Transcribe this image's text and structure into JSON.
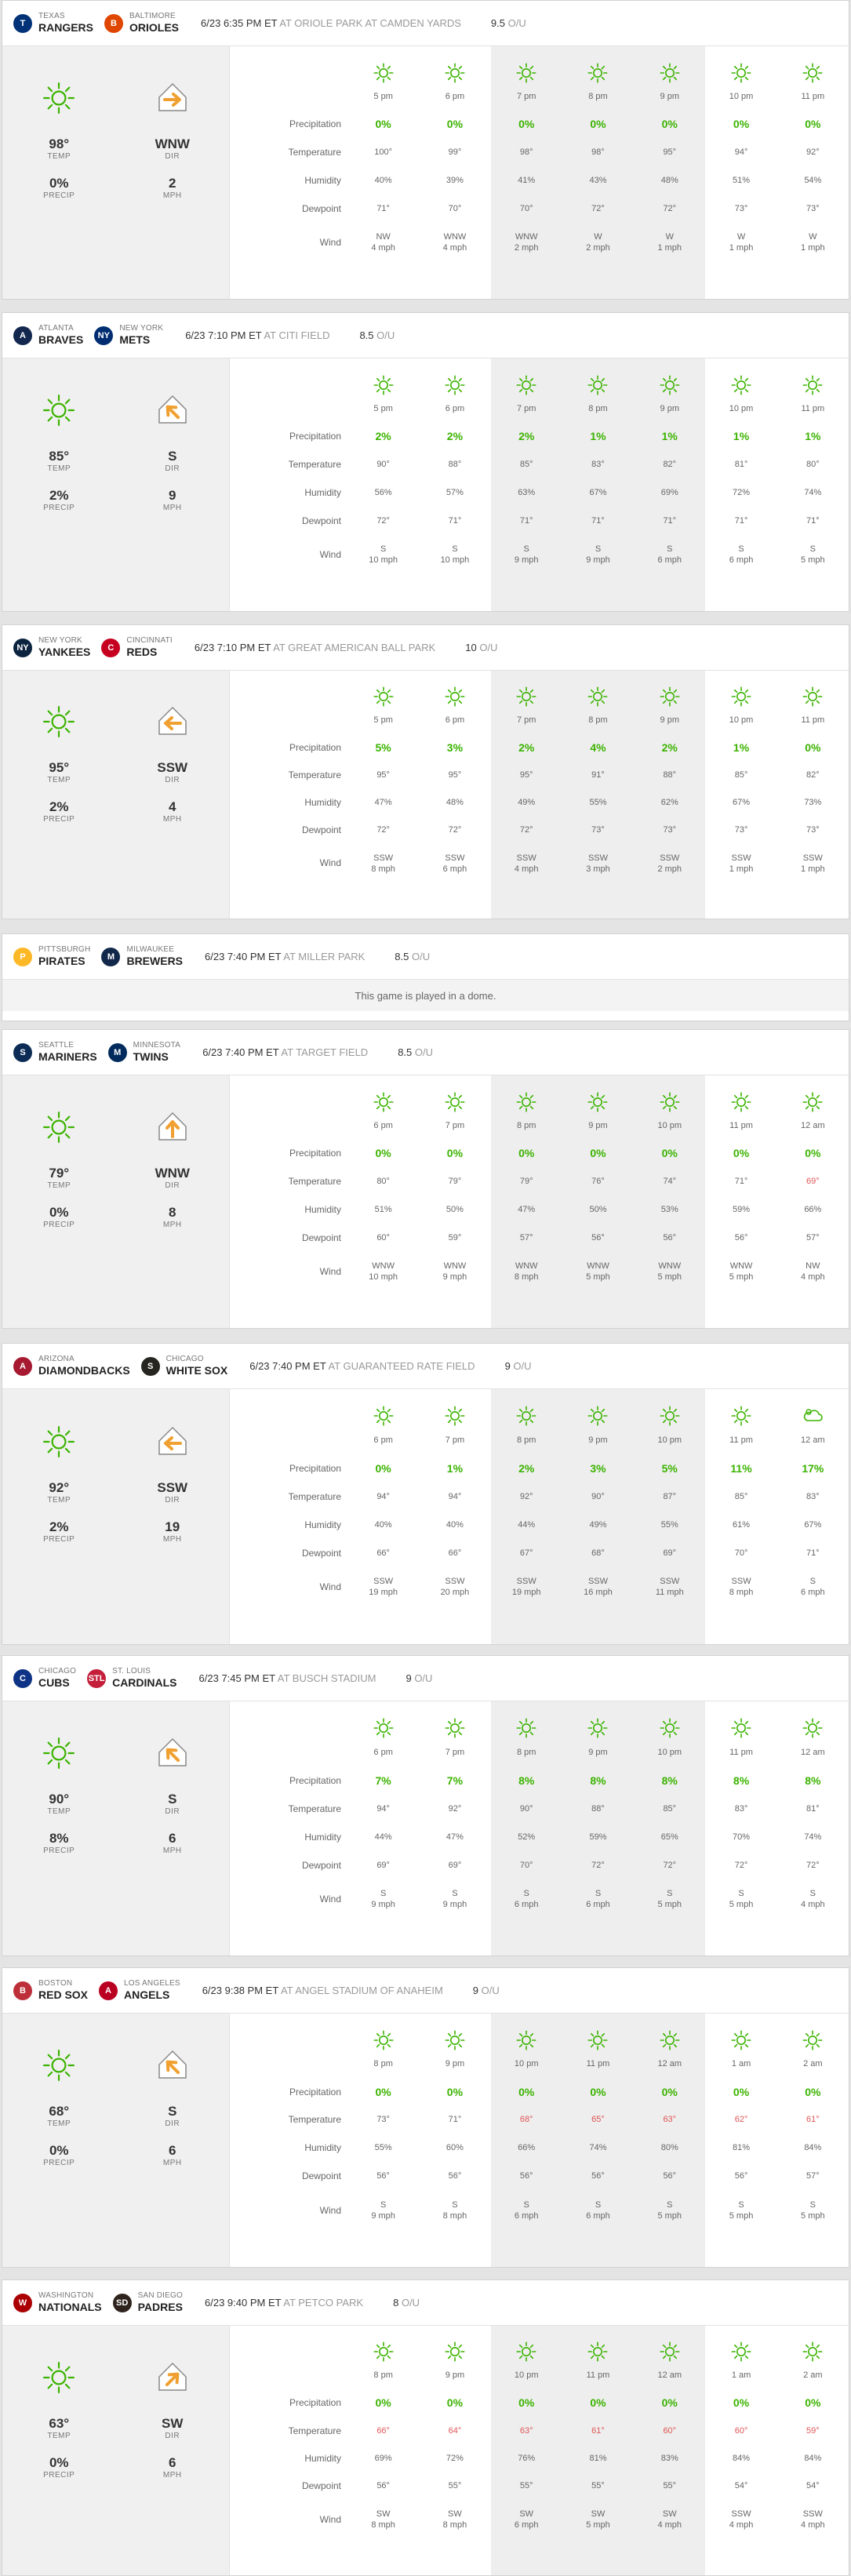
{
  "colors": {
    "accent": "#3bb300",
    "cold": "#e05555"
  },
  "labels": {
    "precipitation": "Precipitation",
    "temperature": "Temperature",
    "humidity": "Humidity",
    "dewpoint": "Dewpoint",
    "wind": "Wind",
    "temp": "TEMP",
    "precip": "PRECIP",
    "dir": "DIR",
    "mph": "MPH",
    "ou": "O/U"
  },
  "games": [
    {
      "away": {
        "city": "Texas",
        "name": "Rangers",
        "color": "#003278",
        "abbr": "T"
      },
      "home": {
        "city": "Baltimore",
        "name": "Orioles",
        "color": "#df4601",
        "abbr": "B"
      },
      "time": "6/23 6:35 PM ET",
      "venue": "AT ORIOLE PARK AT CAMDEN YARDS",
      "ou": "9.5",
      "summary": {
        "temp": "98°",
        "precip": "0%",
        "dir": "WNW",
        "mph": "2",
        "arrow": "right"
      },
      "hours": [
        "5 pm",
        "6 pm",
        "7 pm",
        "8 pm",
        "9 pm",
        "10 pm",
        "11 pm"
      ],
      "icons": [
        "sun",
        "sun",
        "sun",
        "sun",
        "sun",
        "sun",
        "sun"
      ],
      "precip": [
        "0%",
        "0%",
        "0%",
        "0%",
        "0%",
        "0%",
        "0%"
      ],
      "temp": [
        "100°",
        "99°",
        "98°",
        "98°",
        "95°",
        "94°",
        "92°"
      ],
      "cold": [
        false,
        false,
        false,
        false,
        false,
        false,
        false
      ],
      "humidity": [
        "40%",
        "39%",
        "41%",
        "43%",
        "48%",
        "51%",
        "54%"
      ],
      "dewpoint": [
        "71°",
        "70°",
        "70°",
        "72°",
        "72°",
        "73°",
        "73°"
      ],
      "wind_dir": [
        "NW",
        "WNW",
        "WNW",
        "W",
        "W",
        "W",
        "W"
      ],
      "wind_speed": [
        "4 mph",
        "4 mph",
        "2 mph",
        "2 mph",
        "1 mph",
        "1 mph",
        "1 mph"
      ]
    },
    {
      "away": {
        "city": "Atlanta",
        "name": "Braves",
        "color": "#13274f",
        "abbr": "A"
      },
      "home": {
        "city": "New York",
        "name": "Mets",
        "color": "#002d72",
        "abbr": "NY"
      },
      "time": "6/23 7:10 PM ET",
      "venue": "AT CITI FIELD",
      "ou": "8.5",
      "summary": {
        "temp": "85°",
        "precip": "2%",
        "dir": "S",
        "mph": "9",
        "arrow": "upleft"
      },
      "hours": [
        "5 pm",
        "6 pm",
        "7 pm",
        "8 pm",
        "9 pm",
        "10 pm",
        "11 pm"
      ],
      "icons": [
        "sun",
        "sun",
        "sun",
        "sun",
        "sun",
        "sun",
        "sun"
      ],
      "precip": [
        "2%",
        "2%",
        "2%",
        "1%",
        "1%",
        "1%",
        "1%"
      ],
      "temp": [
        "90°",
        "88°",
        "85°",
        "83°",
        "82°",
        "81°",
        "80°"
      ],
      "cold": [
        false,
        false,
        false,
        false,
        false,
        false,
        false
      ],
      "humidity": [
        "56%",
        "57%",
        "63%",
        "67%",
        "69%",
        "72%",
        "74%"
      ],
      "dewpoint": [
        "72°",
        "71°",
        "71°",
        "71°",
        "71°",
        "71°",
        "71°"
      ],
      "wind_dir": [
        "S",
        "S",
        "S",
        "S",
        "S",
        "S",
        "S"
      ],
      "wind_speed": [
        "10 mph",
        "10 mph",
        "9 mph",
        "9 mph",
        "6 mph",
        "6 mph",
        "5 mph"
      ]
    },
    {
      "away": {
        "city": "New York",
        "name": "Yankees",
        "color": "#0c2340",
        "abbr": "NY"
      },
      "home": {
        "city": "Cincinnati",
        "name": "Reds",
        "color": "#c6011f",
        "abbr": "C"
      },
      "time": "6/23 7:10 PM ET",
      "venue": "AT GREAT AMERICAN BALL PARK",
      "ou": "10",
      "summary": {
        "temp": "95°",
        "precip": "2%",
        "dir": "SSW",
        "mph": "4",
        "arrow": "left"
      },
      "hours": [
        "5 pm",
        "6 pm",
        "7 pm",
        "8 pm",
        "9 pm",
        "10 pm",
        "11 pm"
      ],
      "icons": [
        "sun",
        "sun",
        "sun",
        "sun",
        "sun",
        "sun",
        "sun"
      ],
      "precip": [
        "5%",
        "3%",
        "2%",
        "4%",
        "2%",
        "1%",
        "0%"
      ],
      "temp": [
        "95°",
        "95°",
        "95°",
        "91°",
        "88°",
        "85°",
        "82°"
      ],
      "cold": [
        false,
        false,
        false,
        false,
        false,
        false,
        false
      ],
      "humidity": [
        "47%",
        "48%",
        "49%",
        "55%",
        "62%",
        "67%",
        "73%"
      ],
      "dewpoint": [
        "72°",
        "72°",
        "72°",
        "73°",
        "73°",
        "73°",
        "73°"
      ],
      "wind_dir": [
        "SSW",
        "SSW",
        "SSW",
        "SSW",
        "SSW",
        "SSW",
        "SSW"
      ],
      "wind_speed": [
        "8 mph",
        "6 mph",
        "4 mph",
        "3 mph",
        "2 mph",
        "1 mph",
        "1 mph"
      ]
    },
    {
      "away": {
        "city": "Pittsburgh",
        "name": "Pirates",
        "color": "#fdb827",
        "abbr": "P"
      },
      "home": {
        "city": "Milwaukee",
        "name": "Brewers",
        "color": "#12284b",
        "abbr": "M"
      },
      "time": "6/23 7:40 PM ET",
      "venue": "AT MILLER PARK",
      "ou": "8.5",
      "dome": "This game is played in a dome."
    },
    {
      "away": {
        "city": "Seattle",
        "name": "Mariners",
        "color": "#0c2c56",
        "abbr": "S"
      },
      "home": {
        "city": "Minnesota",
        "name": "Twins",
        "color": "#002b5c",
        "abbr": "M"
      },
      "time": "6/23 7:40 PM ET",
      "venue": "AT TARGET FIELD",
      "ou": "8.5",
      "summary": {
        "temp": "79°",
        "precip": "0%",
        "dir": "WNW",
        "mph": "8",
        "arrow": "up"
      },
      "hours": [
        "6 pm",
        "7 pm",
        "8 pm",
        "9 pm",
        "10 pm",
        "11 pm",
        "12 am"
      ],
      "icons": [
        "sun",
        "sun",
        "sun",
        "sun",
        "sun",
        "sun",
        "sun"
      ],
      "precip": [
        "0%",
        "0%",
        "0%",
        "0%",
        "0%",
        "0%",
        "0%"
      ],
      "temp": [
        "80°",
        "79°",
        "79°",
        "76°",
        "74°",
        "71°",
        "69°"
      ],
      "cold": [
        false,
        false,
        false,
        false,
        false,
        false,
        true
      ],
      "humidity": [
        "51%",
        "50%",
        "47%",
        "50%",
        "53%",
        "59%",
        "66%"
      ],
      "dewpoint": [
        "60°",
        "59°",
        "57°",
        "56°",
        "56°",
        "56°",
        "57°"
      ],
      "wind_dir": [
        "WNW",
        "WNW",
        "WNW",
        "WNW",
        "WNW",
        "WNW",
        "NW"
      ],
      "wind_speed": [
        "10 mph",
        "9 mph",
        "8 mph",
        "5 mph",
        "5 mph",
        "5 mph",
        "4 mph"
      ]
    },
    {
      "away": {
        "city": "Arizona",
        "name": "Diamondbacks",
        "color": "#a71930",
        "abbr": "A"
      },
      "home": {
        "city": "Chicago",
        "name": "White Sox",
        "color": "#27251f",
        "abbr": "S"
      },
      "time": "6/23 7:40 PM ET",
      "venue": "AT GUARANTEED RATE FIELD",
      "ou": "9",
      "summary": {
        "temp": "92°",
        "precip": "2%",
        "dir": "SSW",
        "mph": "19",
        "arrow": "left"
      },
      "hours": [
        "6 pm",
        "7 pm",
        "8 pm",
        "9 pm",
        "10 pm",
        "11 pm",
        "12 am"
      ],
      "icons": [
        "sun",
        "sun",
        "sun",
        "sun",
        "sun",
        "sun",
        "cloud"
      ],
      "precip": [
        "0%",
        "1%",
        "2%",
        "3%",
        "5%",
        "11%",
        "17%"
      ],
      "temp": [
        "94°",
        "94°",
        "92°",
        "90°",
        "87°",
        "85°",
        "83°"
      ],
      "cold": [
        false,
        false,
        false,
        false,
        false,
        false,
        false
      ],
      "humidity": [
        "40%",
        "40%",
        "44%",
        "49%",
        "55%",
        "61%",
        "67%"
      ],
      "dewpoint": [
        "66°",
        "66°",
        "67°",
        "68°",
        "69°",
        "70°",
        "71°"
      ],
      "wind_dir": [
        "SSW",
        "SSW",
        "SSW",
        "SSW",
        "SSW",
        "SSW",
        "S"
      ],
      "wind_speed": [
        "19 mph",
        "20 mph",
        "19 mph",
        "16 mph",
        "11 mph",
        "8 mph",
        "6 mph"
      ]
    },
    {
      "away": {
        "city": "Chicago",
        "name": "Cubs",
        "color": "#0e3386",
        "abbr": "C"
      },
      "home": {
        "city": "St. Louis",
        "name": "Cardinals",
        "color": "#c41e3a",
        "abbr": "STL"
      },
      "time": "6/23 7:45 PM ET",
      "venue": "AT BUSCH STADIUM",
      "ou": "9",
      "summary": {
        "temp": "90°",
        "precip": "8%",
        "dir": "S",
        "mph": "6",
        "arrow": "upleft"
      },
      "hours": [
        "6 pm",
        "7 pm",
        "8 pm",
        "9 pm",
        "10 pm",
        "11 pm",
        "12 am"
      ],
      "icons": [
        "sun",
        "sun",
        "sun",
        "sun",
        "sun",
        "sun",
        "sun"
      ],
      "precip": [
        "7%",
        "7%",
        "8%",
        "8%",
        "8%",
        "8%",
        "8%"
      ],
      "temp": [
        "94°",
        "92°",
        "90°",
        "88°",
        "85°",
        "83°",
        "81°"
      ],
      "cold": [
        false,
        false,
        false,
        false,
        false,
        false,
        false
      ],
      "humidity": [
        "44%",
        "47%",
        "52%",
        "59%",
        "65%",
        "70%",
        "74%"
      ],
      "dewpoint": [
        "69°",
        "69°",
        "70°",
        "72°",
        "72°",
        "72°",
        "72°"
      ],
      "wind_dir": [
        "S",
        "S",
        "S",
        "S",
        "S",
        "S",
        "S"
      ],
      "wind_speed": [
        "9 mph",
        "9 mph",
        "6 mph",
        "6 mph",
        "5 mph",
        "5 mph",
        "4 mph"
      ]
    },
    {
      "away": {
        "city": "Boston",
        "name": "Red Sox",
        "color": "#bd3039",
        "abbr": "B"
      },
      "home": {
        "city": "Los Angeles",
        "name": "Angels",
        "color": "#ba0021",
        "abbr": "A"
      },
      "time": "6/23 9:38 PM ET",
      "venue": "AT ANGEL STADIUM OF ANAHEIM",
      "ou": "9",
      "summary": {
        "temp": "68°",
        "precip": "0%",
        "dir": "S",
        "mph": "6",
        "arrow": "upleft"
      },
      "hours": [
        "8 pm",
        "9 pm",
        "10 pm",
        "11 pm",
        "12 am",
        "1 am",
        "2 am"
      ],
      "icons": [
        "sun",
        "sun",
        "sun",
        "sun",
        "sun",
        "sun",
        "sun"
      ],
      "precip": [
        "0%",
        "0%",
        "0%",
        "0%",
        "0%",
        "0%",
        "0%"
      ],
      "temp": [
        "73°",
        "71°",
        "68°",
        "65°",
        "63°",
        "62°",
        "61°"
      ],
      "cold": [
        false,
        false,
        true,
        true,
        true,
        true,
        true
      ],
      "humidity": [
        "55%",
        "60%",
        "66%",
        "74%",
        "80%",
        "81%",
        "84%"
      ],
      "dewpoint": [
        "56°",
        "56°",
        "56°",
        "56°",
        "56°",
        "56°",
        "57°"
      ],
      "wind_dir": [
        "S",
        "S",
        "S",
        "S",
        "S",
        "S",
        "S"
      ],
      "wind_speed": [
        "9 mph",
        "8 mph",
        "6 mph",
        "6 mph",
        "5 mph",
        "5 mph",
        "5 mph"
      ]
    },
    {
      "away": {
        "city": "Washington",
        "name": "Nationals",
        "color": "#ab0003",
        "abbr": "W"
      },
      "home": {
        "city": "San Diego",
        "name": "Padres",
        "color": "#2f241d",
        "abbr": "SD"
      },
      "time": "6/23 9:40 PM ET",
      "venue": "AT PETCO PARK",
      "ou": "8",
      "summary": {
        "temp": "63°",
        "precip": "0%",
        "dir": "SW",
        "mph": "6",
        "arrow": "upright"
      },
      "hours": [
        "8 pm",
        "9 pm",
        "10 pm",
        "11 pm",
        "12 am",
        "1 am",
        "2 am"
      ],
      "icons": [
        "sun",
        "sun",
        "sun",
        "sun",
        "sun",
        "sun",
        "sun"
      ],
      "precip": [
        "0%",
        "0%",
        "0%",
        "0%",
        "0%",
        "0%",
        "0%"
      ],
      "temp": [
        "66°",
        "64°",
        "63°",
        "61°",
        "60°",
        "60°",
        "59°"
      ],
      "cold": [
        true,
        true,
        true,
        true,
        true,
        true,
        true
      ],
      "humidity": [
        "69%",
        "72%",
        "76%",
        "81%",
        "83%",
        "84%",
        "84%"
      ],
      "dewpoint": [
        "56°",
        "55°",
        "55°",
        "55°",
        "55°",
        "54°",
        "54°"
      ],
      "wind_dir": [
        "SW",
        "SW",
        "SW",
        "SW",
        "SW",
        "SSW",
        "SSW"
      ],
      "wind_speed": [
        "8 mph",
        "8 mph",
        "6 mph",
        "5 mph",
        "4 mph",
        "4 mph",
        "4 mph"
      ]
    }
  ]
}
